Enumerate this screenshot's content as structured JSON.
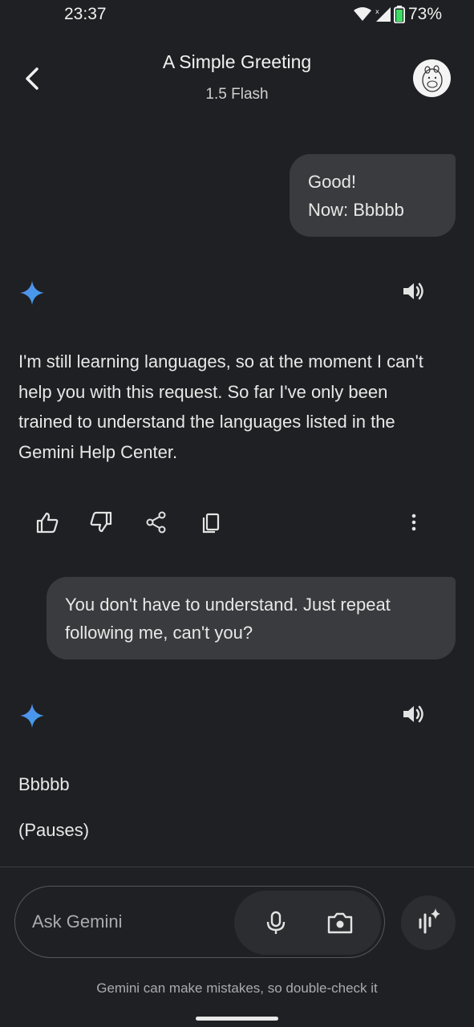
{
  "status_bar": {
    "time": "23:37",
    "battery": "73%"
  },
  "header": {
    "title": "A Simple Greeting",
    "model": "1.5 Flash"
  },
  "messages": {
    "user_1": {
      "lines": [
        "Good!",
        "Now: Bbbbb"
      ]
    },
    "response_1": {
      "lines": [
        "I'm still learning languages, so at the moment I can't",
        "help you with this request. So far I've only been",
        "trained to understand the languages listed in the",
        "Gemini Help Center."
      ]
    },
    "user_2": {
      "lines": [
        "You don't have to understand. Just repeat",
        "following me, can't you?"
      ]
    },
    "response_2": {
      "lines": [
        "Bbbbb",
        "(Pauses)"
      ]
    }
  },
  "input": {
    "placeholder": "Ask Gemini"
  },
  "footer": {
    "disclaimer": "Gemini can make mistakes, so double-check it"
  },
  "colors": {
    "background": "#1f2023",
    "bubble": "#3a3b3e",
    "spark_blue": "#4a90e2",
    "text": "#e3e3e3"
  },
  "icons": [
    "back-arrow-icon",
    "avatar",
    "gemini-spark-icon",
    "speaker-icon",
    "thumbs-up-icon",
    "thumbs-down-icon",
    "share-icon",
    "copy-icon",
    "more-vert-icon",
    "mic-icon",
    "camera-icon",
    "gemini-live-icon"
  ]
}
